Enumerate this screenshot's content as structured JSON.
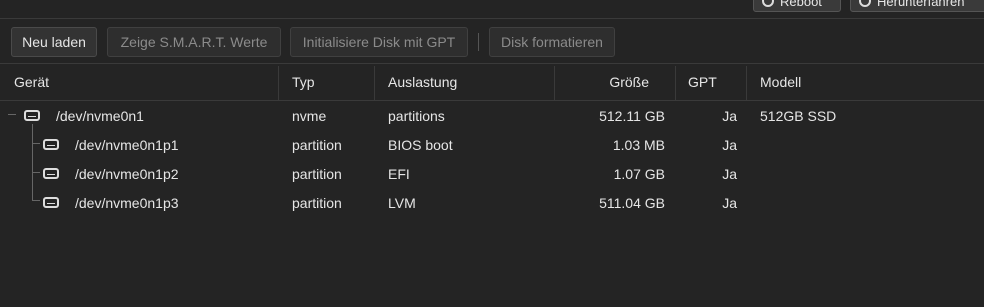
{
  "top_buttons": [
    {
      "label": "Reboot",
      "icon": "reboot-icon"
    },
    {
      "label": "Herunterfahren",
      "icon": "power-icon"
    }
  ],
  "toolbar": {
    "reload": "Neu laden",
    "smart": "Zeige S.M.A.R.T. Werte",
    "init_gpt": "Initialisiere Disk mit GPT",
    "format": "Disk formatieren"
  },
  "columns": [
    "Gerät",
    "Typ",
    "Auslastung",
    "Größe",
    "GPT",
    "Modell"
  ],
  "rows": [
    {
      "device": "/dev/nvme0n1",
      "type": "nvme",
      "usage": "partitions",
      "size": "512.11 GB",
      "gpt": "Ja",
      "model": "512GB SSD"
    },
    {
      "device": "/dev/nvme0n1p1",
      "type": "partition",
      "usage": "BIOS boot",
      "size": "1.03 MB",
      "gpt": "Ja",
      "model": ""
    },
    {
      "device": "/dev/nvme0n1p2",
      "type": "partition",
      "usage": "EFI",
      "size": "1.07 GB",
      "gpt": "Ja",
      "model": ""
    },
    {
      "device": "/dev/nvme0n1p3",
      "type": "partition",
      "usage": "LVM",
      "size": "511.04 GB",
      "gpt": "Ja",
      "model": ""
    }
  ]
}
